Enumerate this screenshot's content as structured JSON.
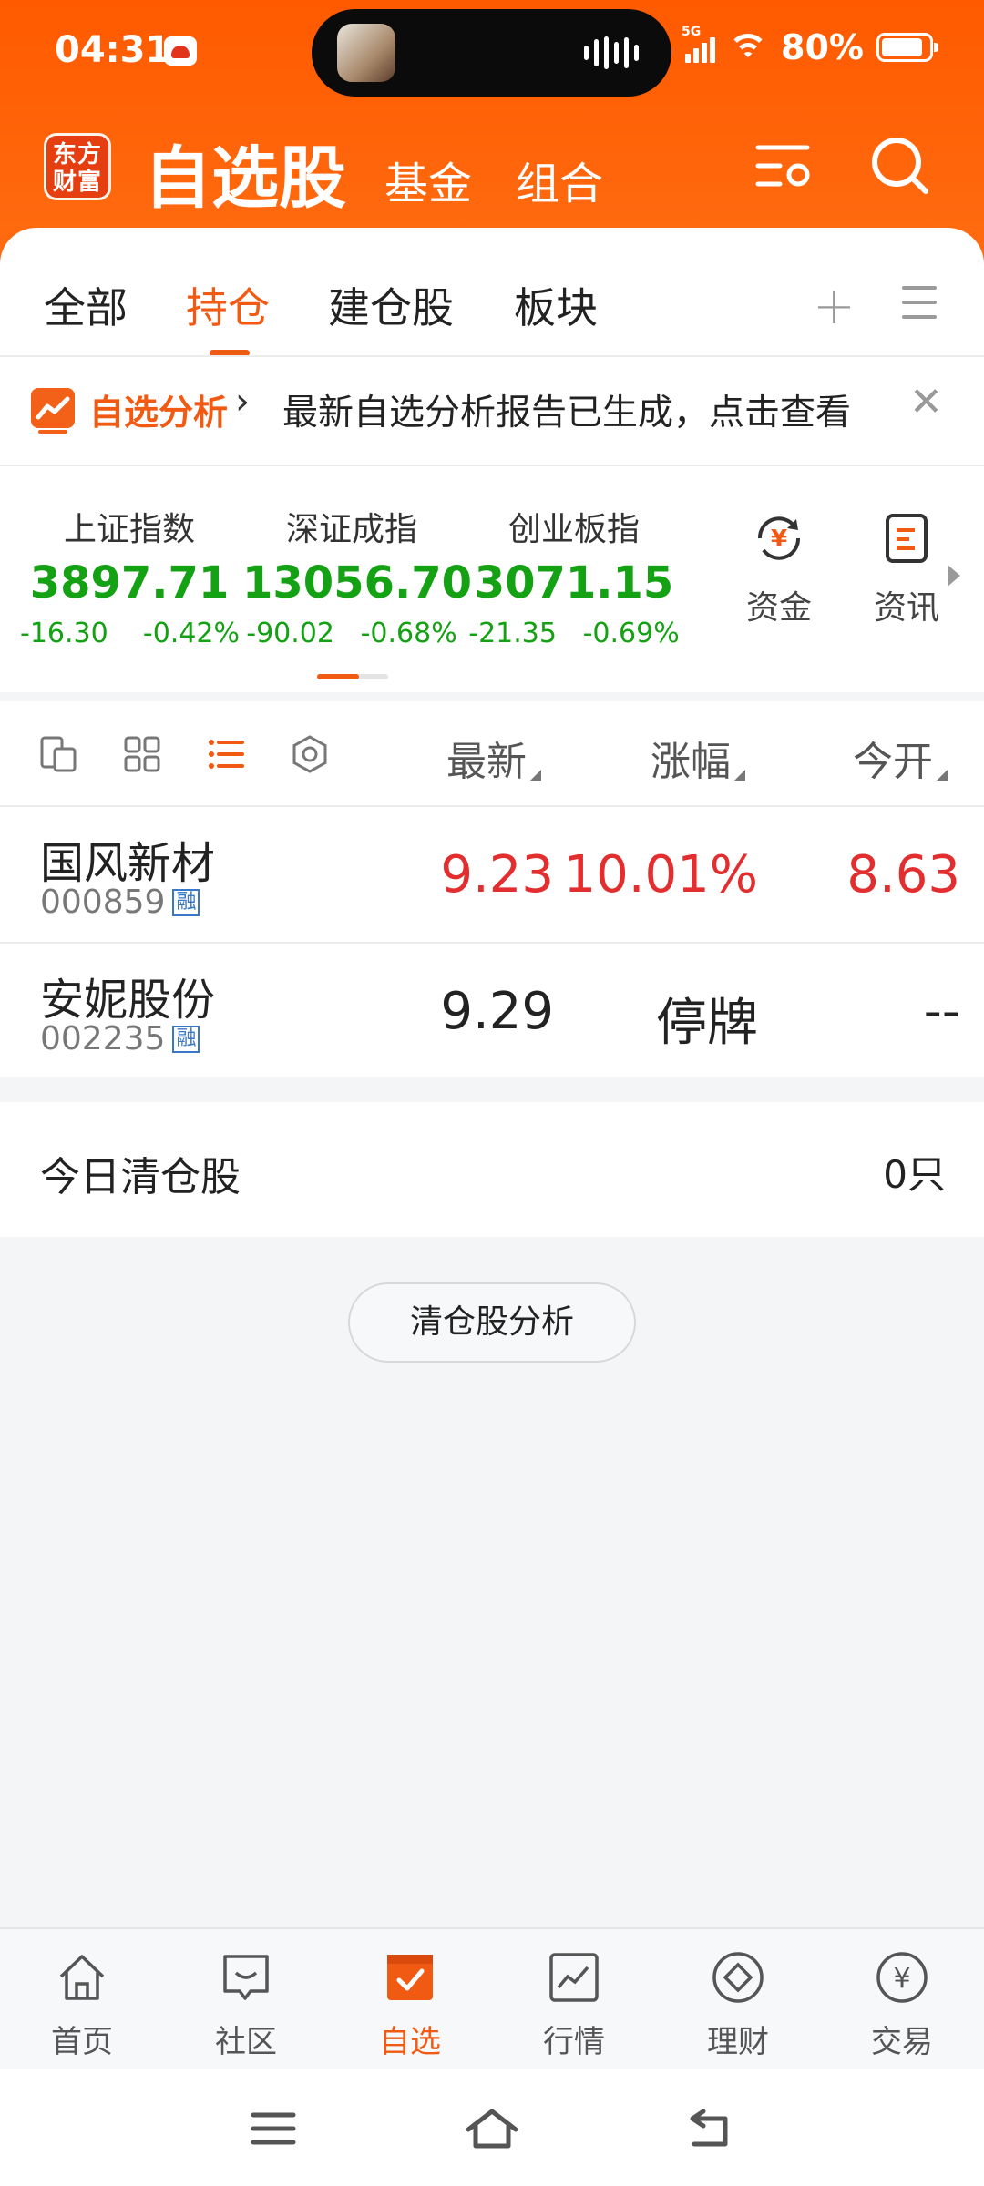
{
  "status_bar": {
    "time": "04:31",
    "network": "5G",
    "battery": "80%"
  },
  "header": {
    "logo_text": "东方财富",
    "title": "自选股",
    "tabs": [
      "基金",
      "组合"
    ]
  },
  "tabs": {
    "items": [
      "全部",
      "持仓",
      "建仓股",
      "板块"
    ],
    "active": "持仓"
  },
  "banner": {
    "label": "自选分析",
    "text": "最新自选分析报告已生成，点击查看"
  },
  "indices": [
    {
      "name": "上证指数",
      "value": "3897.71",
      "change": "-16.30",
      "pct": "-0.42%"
    },
    {
      "name": "深证成指",
      "value": "13056.70",
      "change": "-90.02",
      "pct": "-0.68%"
    },
    {
      "name": "创业板指",
      "value": "3071.15",
      "change": "-21.35",
      "pct": "-0.69%"
    }
  ],
  "quick_links": [
    "资金",
    "资讯"
  ],
  "list": {
    "columns": [
      "最新",
      "涨幅",
      "今开"
    ],
    "rows": [
      {
        "name": "国风新材",
        "code": "000859",
        "tag": "融",
        "latest": "9.23",
        "change": "10.01%",
        "open": "8.63"
      },
      {
        "name": "安妮股份",
        "code": "002235",
        "tag": "融",
        "latest": "9.29",
        "change": "停牌",
        "open": "--"
      }
    ]
  },
  "cleared": {
    "label": "今日清仓股",
    "count": "0只",
    "button": "清仓股分析"
  },
  "bottom_nav": [
    "首页",
    "社区",
    "自选",
    "行情",
    "理财",
    "交易"
  ],
  "colors": {
    "brand": "#f05a13",
    "up": "#e22e2e",
    "down": "#14a114"
  }
}
